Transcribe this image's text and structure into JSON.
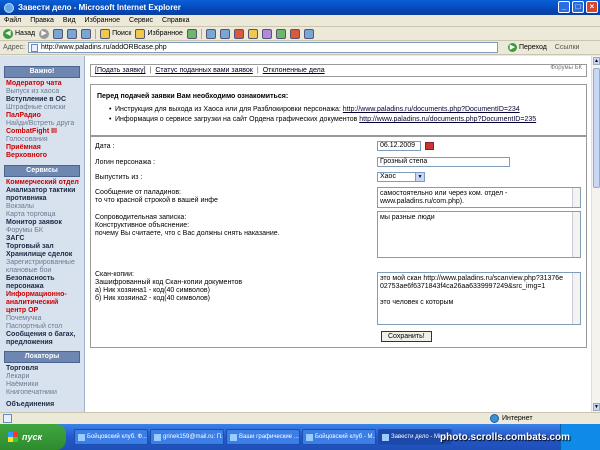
{
  "window": {
    "title": "Завести дело - Microsoft Internet Explorer"
  },
  "menu": [
    "Файл",
    "Правка",
    "Вид",
    "Избранное",
    "Сервис",
    "Справка"
  ],
  "toolbar": {
    "back_label": "Назад",
    "search_label": "Поиск",
    "favorites_label": "Избранное"
  },
  "address": {
    "label": "Адрес:",
    "url": "http://www.paladins.ru/addORBcase.php",
    "go_label": "Переход",
    "links_label": "Ссылки"
  },
  "sidebar": {
    "header_main": "Важно!",
    "main_items": [
      {
        "label": "Модератор чата",
        "style": "red"
      },
      {
        "label": "Выпуск из хаоса",
        "style": "grey"
      },
      {
        "label": "Вступление в ОС",
        "style": "dark"
      },
      {
        "label": "Штрафные списки",
        "style": "grey"
      },
      {
        "label": "ПалРадио",
        "style": "red"
      },
      {
        "label": "Найди/Встреть друга",
        "style": "grey"
      },
      {
        "label": "CombatFight III",
        "style": "red"
      },
      {
        "label": "Голосования",
        "style": "grey"
      },
      {
        "label": "Приёмная",
        "style": "red"
      },
      {
        "label": "Верховного",
        "style": "red"
      }
    ],
    "header_services": "Сервисы",
    "service_items": [
      {
        "label": "Коммерческий отдел",
        "style": "red"
      },
      {
        "label": "Анализатор тактики",
        "style": "dark"
      },
      {
        "label": "противника",
        "style": "dark"
      },
      {
        "label": "Вокзалы",
        "style": "grey"
      },
      {
        "label": "Карта торговца",
        "style": "grey"
      },
      {
        "label": "Монитор заявок",
        "style": "dark"
      },
      {
        "label": "Форумы БК",
        "style": "grey"
      },
      {
        "label": "ЗАГС",
        "style": "dark"
      },
      {
        "label": "Торговый зал",
        "style": "dark"
      },
      {
        "label": "Хранилище сделок",
        "style": "dark"
      },
      {
        "label": "Зарегистрированные",
        "style": "grey"
      },
      {
        "label": "клановые бои",
        "style": "grey"
      },
      {
        "label": "Безопасность",
        "style": "dark"
      },
      {
        "label": "персонажа",
        "style": "dark"
      },
      {
        "label": "Информационно-",
        "style": "red"
      },
      {
        "label": "аналитический",
        "style": "red"
      },
      {
        "label": "центр ОР",
        "style": "red"
      },
      {
        "label": "Почемучка",
        "style": "grey"
      },
      {
        "label": "Паспортный стол",
        "style": "grey"
      },
      {
        "label": "Сообщения о багах,",
        "style": "dark"
      },
      {
        "label": "предложения",
        "style": "dark"
      }
    ],
    "header_locators": "Локаторы",
    "locator_items": [
      {
        "label": "Торговля",
        "style": "dark"
      },
      {
        "label": "Лекари",
        "style": "grey"
      },
      {
        "label": "Наёмники",
        "style": "grey"
      },
      {
        "label": "Книгопечатники",
        "style": "grey"
      }
    ],
    "footer_item": "Объединения"
  },
  "tabs": {
    "submit_tab": "[Подать заявку]",
    "status_tab": "Статус поданных вами заявок",
    "rejected_tab": "Отклоненные дела",
    "right_text": "Форумы БК"
  },
  "notice": {
    "heading": "Перед подачей заявки Вам необходимо ознакомиться:",
    "items": [
      {
        "text": "Инструкция для выхода из Хаоса или для Разблокировки персонажа:",
        "link": "http://www.paladins.ru/documents.php?DocumentID=234"
      },
      {
        "text": "Информация о сервисе загрузки на сайт Ордена графических документов",
        "link": "http://www.paladins.ru/documents.php?DocumentID=235"
      }
    ]
  },
  "form": {
    "date_label": "Дата :",
    "date_value": "06.12.2009",
    "login_label": "Логин персонажа :",
    "login_value": "Грозный степа",
    "release_label": "Выпустить из :",
    "release_value": "Хаос",
    "paladin_msg_label_1": "Сообщение от паладинов:",
    "paladin_msg_label_2": "то что красной строкой в вашей инфе",
    "paladin_msg_value": "самостоятельно или через ком. отдел - www.paladins.ru/com.php).",
    "note_label_1": "Сопроводительная записка:",
    "note_label_2": "Конструктивное объяснение:",
    "note_label_3": "почему Вы считаете, что с Вас должны снять наказание.",
    "note_value": "мы разные люди",
    "scan_label_1": "Скан-копии:",
    "scan_label_2": "Зашифрованный код Скан-копии документов",
    "scan_label_3": "а) Ник хозяина1 - код(40 символов)",
    "scan_label_4": "б) Ник хозяина2 - код(40 символов)",
    "scan_value_1": "это мой скан http://www.paladins.ru/scanview.php?31376e02753ae6f6371843f4ca26aa6339997249&src_img=1",
    "scan_value_2": "это человек с которым",
    "submit_label": "Сохранить!"
  },
  "status": {
    "zone": "Интернет"
  },
  "taskbar": {
    "start_label": "пуск",
    "tasks": [
      {
        "label": "Бойцовский клуб. Ф...",
        "active": false
      },
      {
        "label": "grinek159@mail.ru: П...",
        "active": false
      },
      {
        "label": "Ваши графические ...",
        "active": false
      },
      {
        "label": "Бойцовский клуб - M...",
        "active": false
      },
      {
        "label": "Завести дело - Micr...",
        "active": true
      }
    ]
  },
  "watermark": "photo.scrolls.combats.com"
}
